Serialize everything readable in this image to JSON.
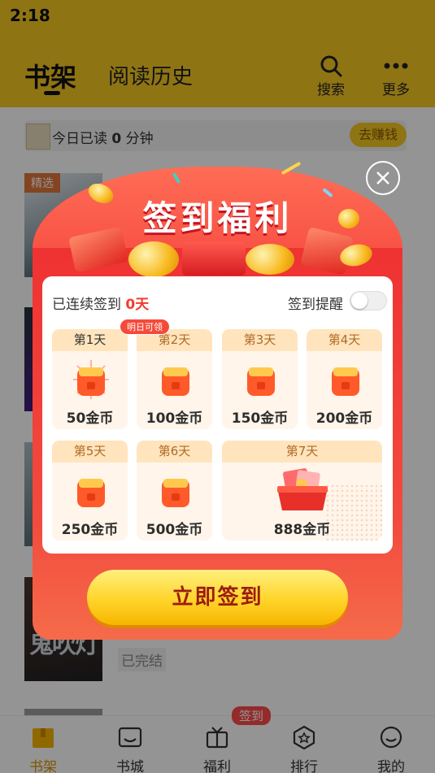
{
  "status_bar": {
    "time": "2:18"
  },
  "header": {
    "tabs": [
      {
        "label": "书架"
      },
      {
        "label": "阅读历史"
      }
    ],
    "actions": [
      {
        "label": "搜索",
        "icon": "search-icon"
      },
      {
        "label": "更多",
        "icon": "more-icon"
      }
    ]
  },
  "reading_bar": {
    "prefix": "今日已读",
    "minutes": "0",
    "suffix": "分钟",
    "earn_label": "去赚钱"
  },
  "books": {
    "featured_tag": "精选",
    "status_finished": "已完结"
  },
  "bottom_nav": {
    "items": [
      {
        "label": "书架",
        "icon": "bookshelf-icon"
      },
      {
        "label": "书城",
        "icon": "bookstore-icon"
      },
      {
        "label": "福利",
        "icon": "welfare-icon"
      },
      {
        "label": "排行",
        "icon": "ranking-icon"
      },
      {
        "label": "我的",
        "icon": "profile-icon"
      }
    ],
    "badge": "签到"
  },
  "popup": {
    "title": "签到福利",
    "streak_prefix": "已连续签到",
    "streak_days": "0天",
    "reminder_label": "签到提醒",
    "reminder_on": false,
    "tomorrow_badge": "明日可领",
    "days": [
      {
        "label": "第1天",
        "reward": "50金币"
      },
      {
        "label": "第2天",
        "reward": "100金币"
      },
      {
        "label": "第3天",
        "reward": "150金币"
      },
      {
        "label": "第4天",
        "reward": "200金币"
      },
      {
        "label": "第5天",
        "reward": "250金币"
      },
      {
        "label": "第6天",
        "reward": "500金币"
      },
      {
        "label": "第7天",
        "reward": "888金币"
      }
    ],
    "button_label": "立即签到"
  },
  "colors": {
    "accent_yellow": "#f6c823",
    "popup_red": "#ef3232",
    "button_yellow": "#ffd42a"
  }
}
